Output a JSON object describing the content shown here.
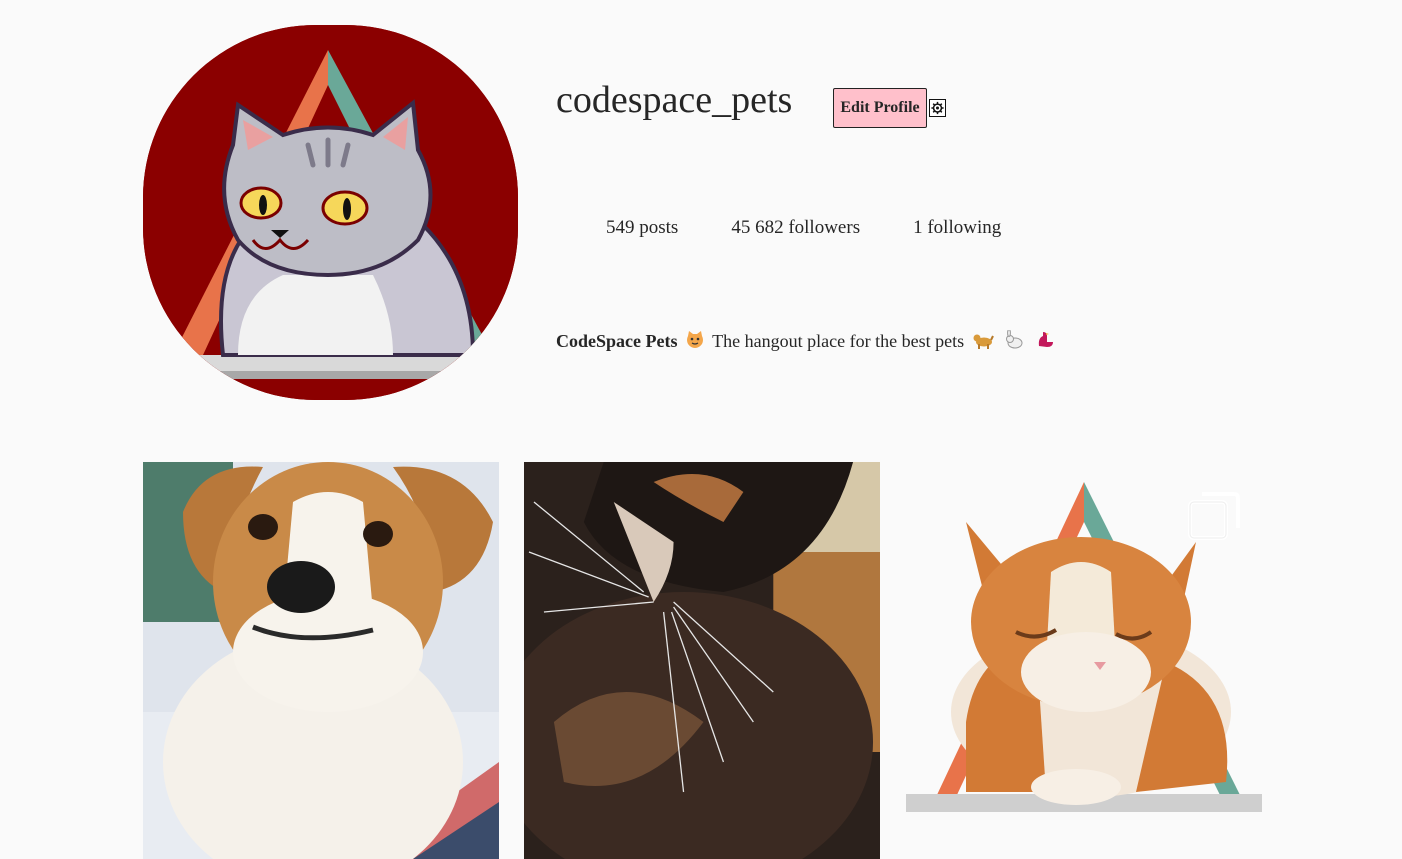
{
  "profile": {
    "username": "codespace_pets",
    "edit_label": "Edit Profile",
    "settings_icon": "gear-icon",
    "avatar_icon": "cat-on-triangle-logo"
  },
  "stats": {
    "posts": "549 posts",
    "followers": "45 682 followers",
    "following": "1 following"
  },
  "bio": {
    "name": "CodeSpace Pets",
    "text": "The hangout place for the best pets",
    "emoji_name": "cat-face-emoji",
    "emoji_tail": [
      "dog-emoji",
      "rabbit-emoji",
      "bird-emoji"
    ]
  },
  "posts": [
    {
      "subject": "puppy-photo"
    },
    {
      "subject": "calico-cat-photo"
    },
    {
      "subject": "orange-cat-photo",
      "badge_icon": "carousel-icon"
    }
  ],
  "colors": {
    "background": "#fafafa",
    "avatar_bg": "#8b0000",
    "edit_button": "#ffc0cb",
    "triangle_orange": "#e8734a",
    "triangle_teal": "#6aa898"
  }
}
